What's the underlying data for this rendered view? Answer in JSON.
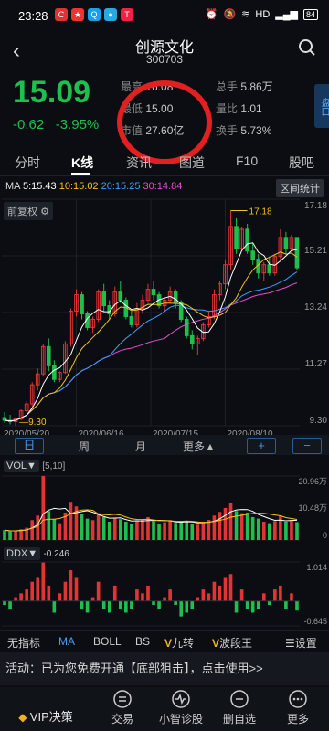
{
  "status": {
    "time": "23:28",
    "network": "HD",
    "signal": "4G",
    "battery": "84"
  },
  "header": {
    "title": "创源文化",
    "code": "300703"
  },
  "quote": {
    "price": "15.09",
    "change": "-0.62",
    "change_pct": "-3.95%",
    "high_label": "最高",
    "high": "16.08",
    "low_label": "最低",
    "low": "15.00",
    "mktcap_label": "市值",
    "mktcap": "27.60亿",
    "vol_label": "总手",
    "vol": "5.86万",
    "ratio_label": "量比",
    "ratio": "1.01",
    "turnover_label": "换手",
    "turnover": "5.73%",
    "side_label": "盘口"
  },
  "tabs": [
    "分时",
    "K线",
    "资讯",
    "图道",
    "F10",
    "股吧"
  ],
  "ma": {
    "label": "MA",
    "ma5": "5:15.43",
    "ma10": "10:15.02",
    "ma20": "20:15.25",
    "ma30": "30:14.84"
  },
  "buttons": {
    "interval": "区间统计",
    "fq": "前复权"
  },
  "colors": {
    "up": "#e23434",
    "down": "#1fbf4f",
    "ma5": "#ffffff",
    "ma10": "#f2c316",
    "ma20": "#3aa0ff",
    "ma30": "#e14fd0"
  },
  "chart_data": [
    {
      "type": "candlestick",
      "title": "K线",
      "xlabel_ticks": [
        "2020/05/20",
        "2020/06/16",
        "2020/07/15",
        "2020/08/10"
      ],
      "y_ticks": [
        "17.18",
        "15.21",
        "13.24",
        "11.27",
        "9.30"
      ],
      "ylim": [
        9.3,
        17.6
      ],
      "annotations": {
        "max": "17.18",
        "min": "9.30"
      },
      "candles": [
        [
          9.6,
          9.8,
          9.4,
          9.5
        ],
        [
          9.5,
          9.7,
          9.35,
          9.45
        ],
        [
          9.45,
          9.6,
          9.3,
          9.55
        ],
        [
          9.55,
          9.9,
          9.5,
          9.85
        ],
        [
          9.85,
          10.2,
          9.8,
          10.1
        ],
        [
          10.1,
          10.9,
          10.0,
          10.8
        ],
        [
          10.8,
          11.4,
          10.6,
          11.2
        ],
        [
          11.2,
          12.3,
          11.1,
          12.2
        ],
        [
          12.2,
          12.5,
          11.3,
          11.5
        ],
        [
          11.5,
          11.7,
          10.9,
          11.0
        ],
        [
          11.0,
          11.3,
          10.9,
          11.25
        ],
        [
          11.25,
          12.4,
          11.2,
          12.3
        ],
        [
          12.3,
          13.6,
          12.2,
          13.5
        ],
        [
          13.5,
          14.3,
          13.3,
          14.1
        ],
        [
          14.1,
          14.2,
          13.2,
          13.4
        ],
        [
          13.4,
          13.5,
          12.8,
          12.9
        ],
        [
          12.9,
          13.3,
          12.7,
          13.2
        ],
        [
          13.2,
          14.3,
          13.1,
          14.2
        ],
        [
          14.2,
          14.5,
          13.5,
          13.7
        ],
        [
          13.7,
          13.9,
          13.2,
          13.4
        ],
        [
          13.4,
          14.4,
          13.3,
          14.2
        ],
        [
          14.2,
          14.6,
          13.8,
          13.9
        ],
        [
          13.9,
          14.0,
          13.2,
          13.3
        ],
        [
          13.3,
          13.5,
          12.9,
          13.0
        ],
        [
          13.0,
          13.8,
          12.9,
          13.6
        ],
        [
          13.6,
          14.1,
          13.4,
          13.9
        ],
        [
          13.9,
          14.5,
          13.8,
          14.3
        ],
        [
          14.3,
          14.6,
          13.9,
          14.1
        ],
        [
          14.1,
          14.2,
          13.6,
          13.7
        ],
        [
          13.7,
          14.0,
          13.5,
          13.9
        ],
        [
          13.9,
          14.4,
          13.8,
          14.2
        ],
        [
          14.2,
          14.3,
          13.6,
          13.8
        ],
        [
          13.8,
          13.9,
          13.1,
          13.2
        ],
        [
          13.2,
          13.3,
          12.5,
          12.6
        ],
        [
          12.6,
          12.8,
          12.1,
          12.3
        ],
        [
          12.3,
          12.6,
          11.9,
          12.5
        ],
        [
          12.5,
          13.1,
          12.4,
          13.0
        ],
        [
          13.0,
          13.5,
          12.9,
          13.3
        ],
        [
          13.3,
          14.3,
          13.2,
          14.1
        ],
        [
          14.1,
          14.6,
          13.9,
          14.5
        ],
        [
          14.5,
          15.4,
          14.3,
          15.2
        ],
        [
          15.2,
          17.18,
          15.0,
          16.6
        ],
        [
          16.6,
          16.9,
          15.6,
          15.8
        ],
        [
          15.8,
          16.6,
          15.7,
          16.5
        ],
        [
          16.5,
          16.7,
          15.6,
          15.7
        ],
        [
          15.7,
          16.0,
          15.2,
          15.4
        ],
        [
          15.4,
          15.6,
          14.7,
          14.9
        ],
        [
          14.9,
          15.3,
          14.6,
          15.2
        ],
        [
          15.2,
          15.5,
          14.8,
          14.9
        ],
        [
          14.9,
          15.6,
          14.8,
          15.5
        ],
        [
          15.5,
          16.5,
          15.4,
          16.2
        ],
        [
          16.2,
          16.4,
          15.6,
          15.8
        ],
        [
          15.8,
          16.3,
          15.7,
          16.2
        ],
        [
          16.2,
          16.08,
          15.0,
          15.09
        ]
      ]
    },
    {
      "type": "bar",
      "title": "VOL",
      "params": "[5,10]",
      "y_ticks": [
        "20.96万",
        "10.48万",
        "0"
      ],
      "ylim": [
        0,
        20.96
      ],
      "values": [
        3.2,
        2.8,
        3.0,
        3.5,
        4.0,
        6.5,
        8.0,
        21.0,
        9.5,
        6.8,
        5.5,
        9.0,
        12.5,
        11.0,
        8.5,
        7.0,
        6.5,
        8.8,
        7.5,
        6.0,
        7.2,
        6.8,
        6.0,
        5.2,
        6.3,
        6.8,
        7.5,
        6.2,
        5.4,
        5.8,
        6.5,
        5.6,
        5.9,
        6.2,
        5.3,
        5.0,
        6.0,
        6.6,
        8.0,
        9.2,
        10.5,
        12.0,
        9.5,
        8.8,
        9.0,
        7.5,
        7.0,
        6.0,
        5.5,
        6.2,
        7.8,
        6.0,
        6.5,
        5.86
      ]
    },
    {
      "type": "bar",
      "title": "DDX",
      "current": "-0.246",
      "y_ticks": [
        "1.014",
        "-0.645"
      ],
      "ylim": [
        -0.645,
        1.014
      ],
      "values": [
        -0.1,
        -0.2,
        0.1,
        0.2,
        0.3,
        0.5,
        0.6,
        1.0,
        0.4,
        -0.3,
        0.2,
        0.5,
        0.8,
        0.6,
        -0.2,
        -0.3,
        0.1,
        0.5,
        -0.2,
        -0.3,
        0.4,
        -0.2,
        -0.3,
        -0.2,
        0.3,
        0.2,
        0.4,
        -0.1,
        -0.2,
        0.1,
        0.3,
        -0.1,
        -0.4,
        -0.3,
        -0.2,
        0.1,
        0.3,
        0.2,
        0.5,
        0.4,
        0.6,
        0.7,
        -0.3,
        0.3,
        -0.2,
        -0.3,
        -0.2,
        0.2,
        -0.1,
        0.3,
        0.4,
        -0.2,
        0.2,
        -0.246
      ]
    }
  ],
  "periods": {
    "day": "日",
    "week": "周",
    "month": "月",
    "more": "更多▲",
    "zoom_in": "+",
    "zoom_out": "−"
  },
  "vol_tag": "VOL▼",
  "ddx_tag": "DDX▼",
  "indicators": [
    "无指标",
    "MA",
    "BOLL",
    "BS",
    "九转",
    "波段王",
    "设置"
  ],
  "promo": "活动：已为您免费开通【底部狙击】，点击使用>>",
  "nav": {
    "vip": "VIP决策",
    "trade": "交易",
    "diagnose": "小智诊股",
    "delete": "删自选",
    "more": "更多"
  }
}
